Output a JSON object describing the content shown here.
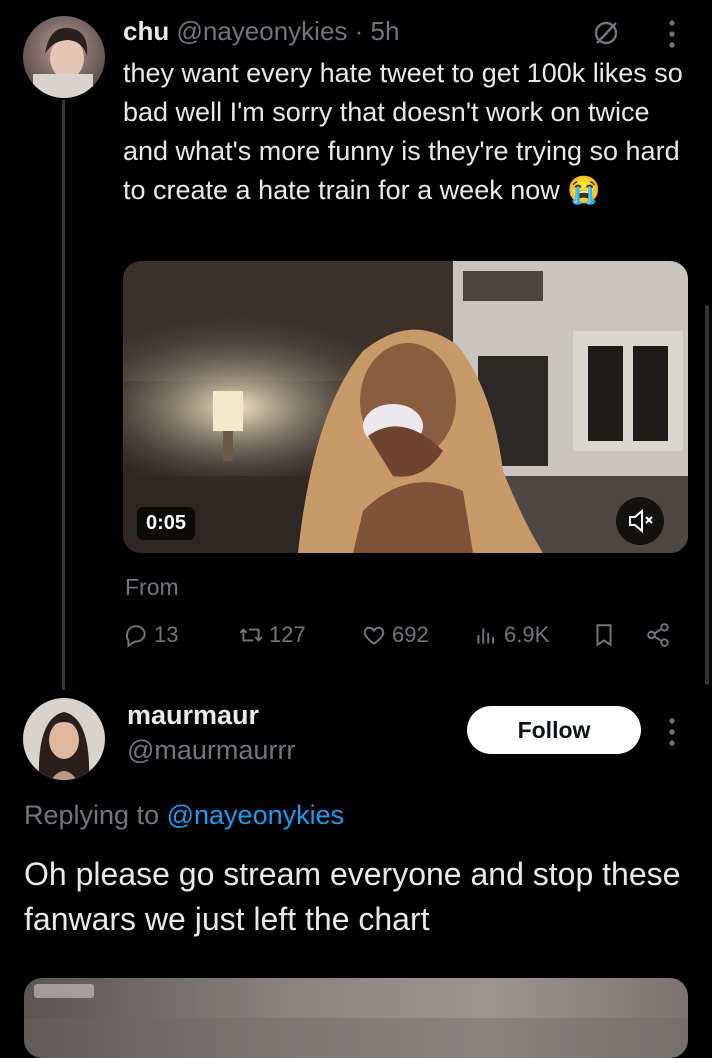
{
  "tweet": {
    "author_name": "chu",
    "handle": "@nayeonykies",
    "separator": "·",
    "time": "5h",
    "text": "they want every hate tweet to get 100k likes so bad well I'm sorry that doesn't work on twice and what's more funny is they're trying so hard to create a hate train for a week now",
    "emoji": "😭",
    "video_time": "0:05",
    "from_label": "From",
    "stats": {
      "replies": "13",
      "reposts": "127",
      "likes": "692",
      "views": "6.9K"
    }
  },
  "reply": {
    "author_name": "maurmaur",
    "handle": "@maurmaurrr",
    "follow_label": "Follow",
    "replying_prefix": "Replying to",
    "replying_to": "@nayeonykies",
    "text": "Oh please go stream everyone and stop these fanwars we just left the chart"
  },
  "icons": [
    "no-repost-icon",
    "more-icon",
    "mute-icon",
    "reply-icon",
    "repost-icon",
    "like-icon",
    "views-icon",
    "bookmark-icon",
    "share-icon"
  ],
  "colors": {
    "background": "#000000",
    "text": "#e7e9ea",
    "muted": "#71767b",
    "link": "#1d9bf0",
    "follow_bg": "#ffffff"
  }
}
